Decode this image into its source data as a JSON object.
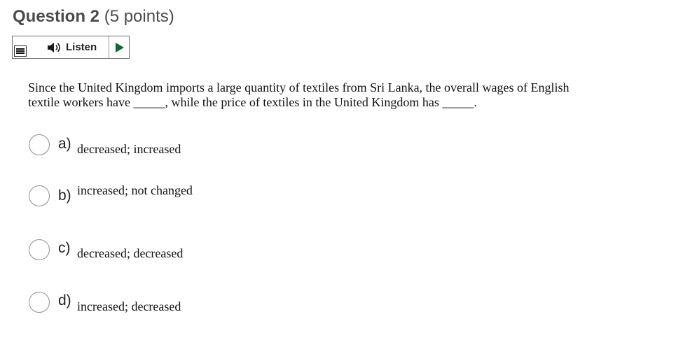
{
  "question": {
    "title": "Question 2",
    "points": "(5 points)"
  },
  "listen_bar": {
    "menu_icon": "menu-icon",
    "speaker_icon": "speaker-icon",
    "listen_label": "Listen",
    "play_icon": "play-icon",
    "play_color": "#0b6b2c"
  },
  "body": {
    "line1": "Since the United Kingdom imports a large quantity of textiles from Sri Lanka, the overall wages of English",
    "line2": "textile workers have _____, while the price of textiles in the United Kingdom has _____."
  },
  "options": [
    {
      "letter": "a)",
      "text": "decreased; increased"
    },
    {
      "letter": "b)",
      "text": "increased; not changed"
    },
    {
      "letter": "c)",
      "text": "decreased; decreased"
    },
    {
      "letter": "d)",
      "text": "increased; decreased"
    }
  ]
}
